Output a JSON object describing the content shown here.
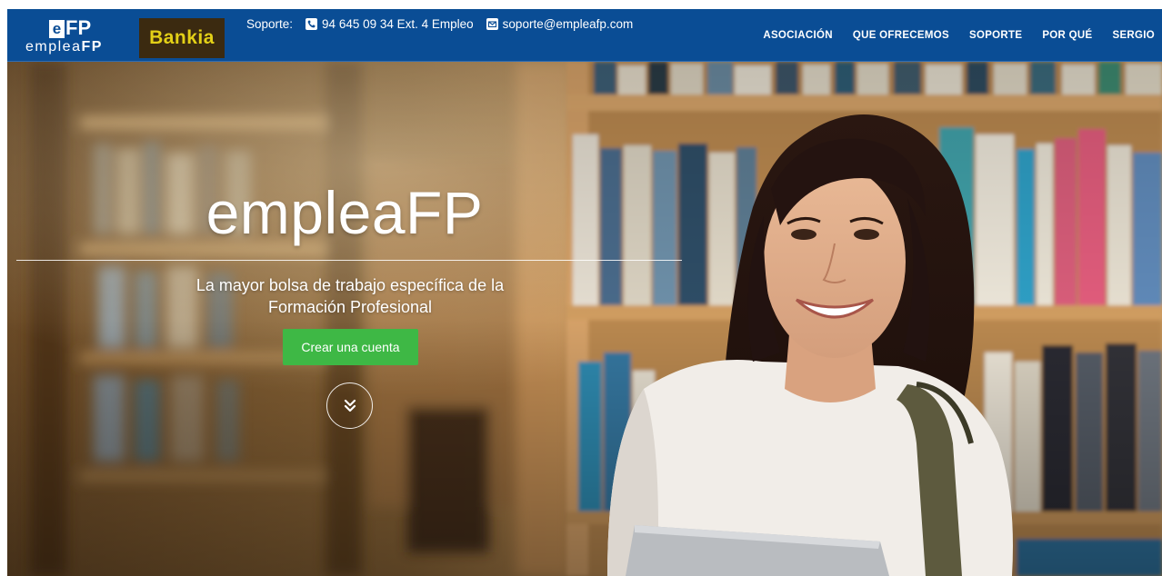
{
  "brand": {
    "logo_mark_e": "e",
    "logo_mark_fp": "FP",
    "logo_text_light": "emplea",
    "logo_text_bold": "FP",
    "partner_name": "Bankia"
  },
  "support": {
    "label": "Soporte:",
    "phone": "94 645 09 34 Ext. 4 Empleo",
    "email": "soporte@empleafp.com"
  },
  "nav": {
    "items": [
      {
        "label": "ASOCIACIÓN"
      },
      {
        "label": "QUE OFRECEMOS"
      },
      {
        "label": "SOPORTE"
      },
      {
        "label": "POR QUÉ"
      },
      {
        "label": "SERGIO"
      }
    ]
  },
  "hero": {
    "title": "empleaFP",
    "subtitle": "La mayor bolsa de trabajo específica de la Formación Profesional",
    "cta_label": "Crear una cuenta",
    "scroll_icon": "double-chevron-down-icon"
  },
  "colors": {
    "navbar": "#0a4d95",
    "cta": "#3eb845",
    "partner_bg": "#3b2a10",
    "partner_text": "#e3d017"
  }
}
